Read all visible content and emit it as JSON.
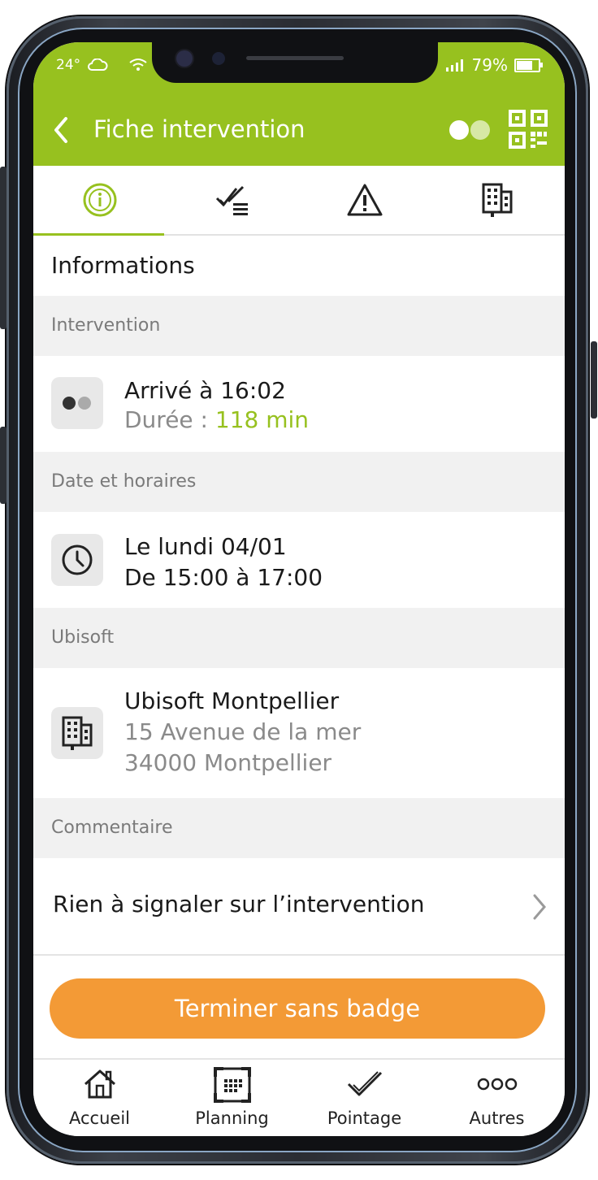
{
  "status_bar": {
    "temperature": "24°",
    "battery": "79%",
    "battery_level": 0.79
  },
  "header": {
    "title": "Fiche intervention",
    "back_icon": "chevron-left-icon",
    "toggle_icon": "toggle-icon",
    "qr_icon": "qr-code-icon"
  },
  "tabs": [
    {
      "icon": "info-icon",
      "active": true
    },
    {
      "icon": "checklist-icon",
      "active": false
    },
    {
      "icon": "warning-icon",
      "active": false
    },
    {
      "icon": "building-icon",
      "active": false
    }
  ],
  "page": {
    "section_title": "Informations"
  },
  "intervention": {
    "group_label": "Intervention",
    "arrived": "Arrivé à 16:02",
    "duration_label": "Durée : ",
    "duration_value": "118 min"
  },
  "schedule": {
    "group_label": "Date et horaires",
    "date": "Le lundi 04/01",
    "hours": "De 15:00 à 17:00"
  },
  "client": {
    "group_label": "Ubisoft",
    "name": "Ubisoft Montpellier",
    "address1": "15 Avenue de la mer",
    "address2": "34000 Montpellier"
  },
  "comment": {
    "group_label": "Commentaire",
    "text": "Rien à signaler sur l’intervention"
  },
  "cta": {
    "label": "Terminer sans badge"
  },
  "bottom_nav": [
    {
      "label": "Accueil",
      "icon": "home-icon"
    },
    {
      "label": "Planning",
      "icon": "calendar-icon"
    },
    {
      "label": "Pointage",
      "icon": "check-icon"
    },
    {
      "label": "Autres",
      "icon": "more-icon"
    }
  ],
  "colors": {
    "brand_green": "#97c11f",
    "accent_orange": "#f39a36",
    "group_bg": "#f1f1f1"
  }
}
